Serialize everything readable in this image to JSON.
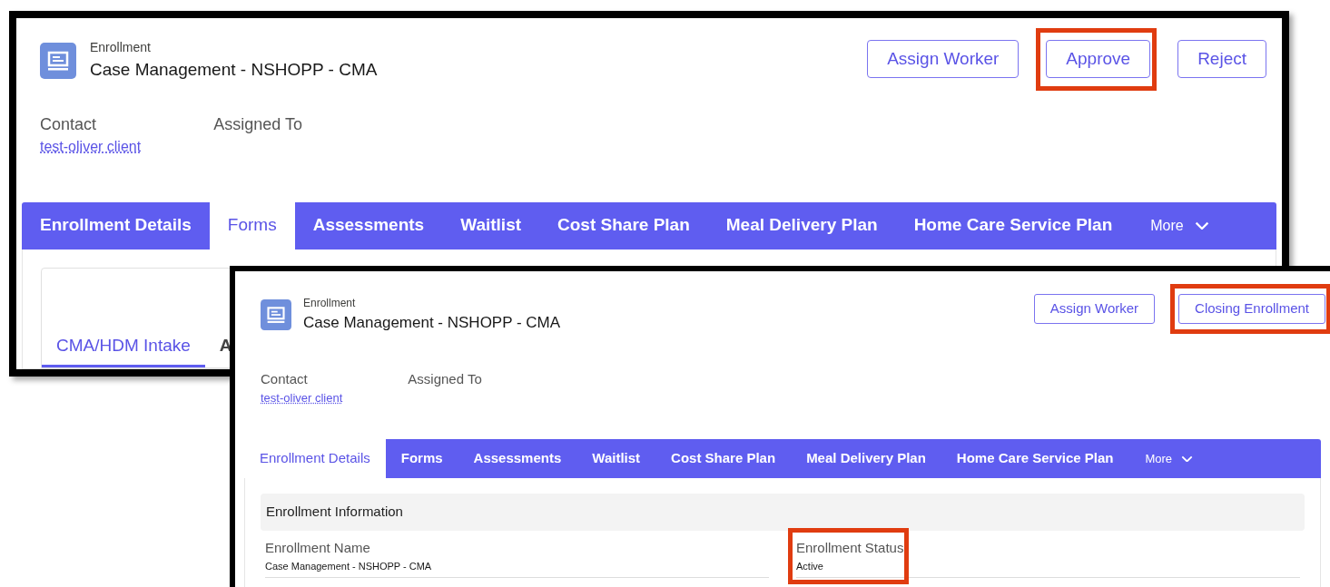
{
  "screens": [
    {
      "object_type": "Enrollment",
      "title": "Case Management - NSHOPP - CMA",
      "actions": [
        {
          "label": "Assign Worker",
          "highlighted": false
        },
        {
          "label": "Approve",
          "highlighted": true
        },
        {
          "label": "Reject",
          "highlighted": false
        }
      ],
      "fields": [
        {
          "label": "Contact",
          "value": "test-oliver client"
        },
        {
          "label": "Assigned To"
        }
      ],
      "tabs": [
        {
          "label": "Enrollment Details",
          "selected": false
        },
        {
          "label": "Forms",
          "selected": true
        },
        {
          "label": "Assessments",
          "selected": false
        },
        {
          "label": "Waitlist",
          "selected": false
        },
        {
          "label": "Cost Share Plan",
          "selected": false
        },
        {
          "label": "Meal Delivery Plan",
          "selected": false
        },
        {
          "label": "Home Care Service Plan",
          "selected": false
        }
      ],
      "more": "More",
      "subtabs": [
        {
          "label": "CMA/HDM Intake",
          "selected": true
        },
        {
          "label": "A",
          "selected": false
        }
      ]
    },
    {
      "object_type": "Enrollment",
      "title": "Case Management - NSHOPP - CMA",
      "actions": [
        {
          "label": "Assign Worker",
          "highlighted": false
        },
        {
          "label": "Closing Enrollment",
          "highlighted": true
        }
      ],
      "fields": [
        {
          "label": "Contact",
          "value": "test-oliver client"
        },
        {
          "label": "Assigned To"
        }
      ],
      "tabs": [
        {
          "label": "Enrollment Details",
          "selected": true
        },
        {
          "label": "Forms",
          "selected": false
        },
        {
          "label": "Assessments",
          "selected": false
        },
        {
          "label": "Waitlist",
          "selected": false
        },
        {
          "label": "Cost Share Plan",
          "selected": false
        },
        {
          "label": "Meal Delivery Plan",
          "selected": false
        },
        {
          "label": "Home Care Service Plan",
          "selected": false
        }
      ],
      "more": "More",
      "section": {
        "title": "Enrollment Information",
        "fields": [
          {
            "label": "Enrollment Name",
            "value": "Case Management - NSHOPP - CMA",
            "highlighted": false
          },
          {
            "label": "Enrollment Status",
            "value": "Active",
            "highlighted": true
          }
        ]
      }
    }
  ]
}
